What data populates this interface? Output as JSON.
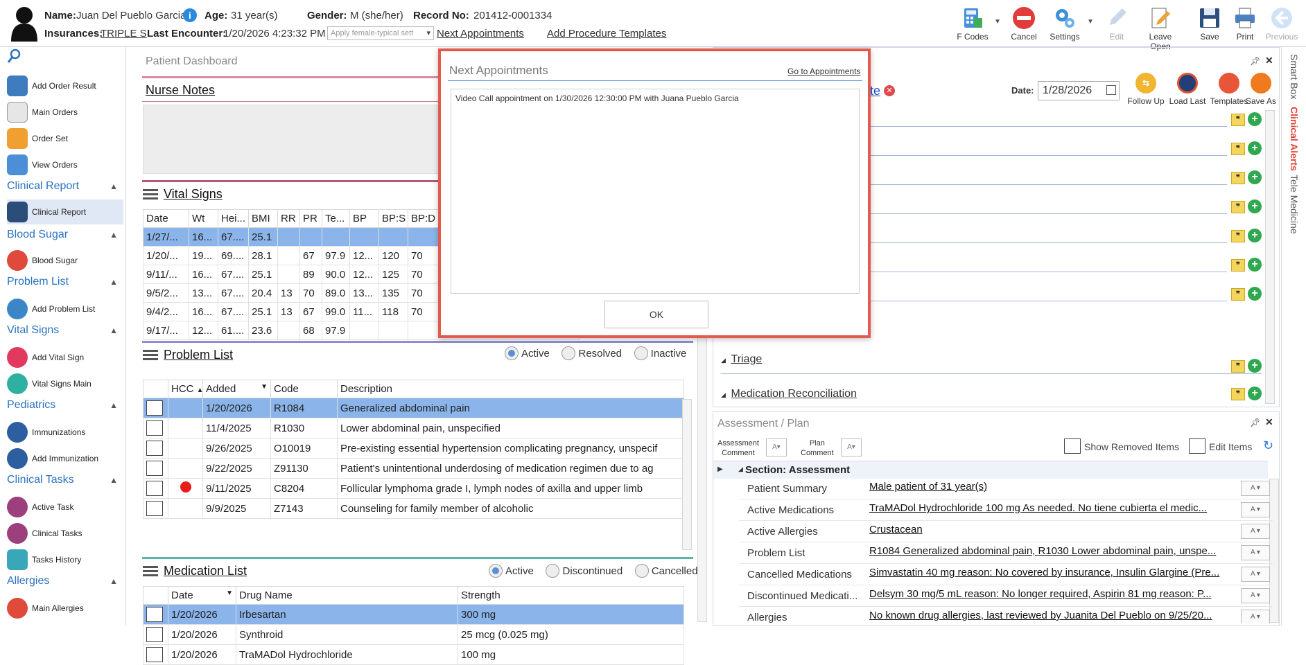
{
  "header": {
    "name_label": "Name:",
    "name_value": "Juan Del Pueblo Garcia",
    "age_label": "Age:",
    "age_value": "31 year(s)",
    "gender_label": "Gender:",
    "gender_value": "M (she/her)",
    "record_label": "Record No:",
    "record_value": "201412-0001334",
    "ins_label": "Insurances:",
    "ins_value": "TRIPLE S",
    "last_enc_label": "Last Encounter:",
    "last_enc_value": "1/20/2026 4:23:32 PM",
    "template_select": "Apply female-typical sett",
    "next_appts_link": "Next Appointments",
    "add_proc_link": "Add Procedure Templates"
  },
  "toolbar": [
    {
      "label": "F Codes",
      "icon": "calculator-icon",
      "enabled": true
    },
    {
      "label": "Cancel",
      "icon": "cancel-icon",
      "enabled": true
    },
    {
      "label": "Settings",
      "icon": "gear-icon",
      "enabled": true
    },
    {
      "label": "Edit",
      "icon": "pencil-icon",
      "enabled": false
    },
    {
      "label": "Leave Open",
      "icon": "edit-doc-icon",
      "enabled": true
    },
    {
      "label": "Save",
      "icon": "floppy-icon",
      "enabled": true
    },
    {
      "label": "Print",
      "icon": "printer-icon",
      "enabled": true
    },
    {
      "label": "Previous",
      "icon": "back-arrow-icon",
      "enabled": false
    }
  ],
  "sidebar": {
    "items": [
      {
        "label": "Add Order Result"
      },
      {
        "label": "Main Orders"
      },
      {
        "label": "Order Set"
      },
      {
        "label": "View Orders"
      }
    ],
    "sections": [
      {
        "title": "Clinical Report",
        "items": [
          "Clinical Report"
        ]
      },
      {
        "title": "Blood Sugar",
        "items": [
          "Blood Sugar"
        ]
      },
      {
        "title": "Problem List",
        "items": [
          "Add Problem List"
        ]
      },
      {
        "title": "Vital Signs",
        "items": [
          "Add Vital Sign",
          "Vital Signs Main"
        ]
      },
      {
        "title": "Pediatrics",
        "items": [
          "Immunizations",
          "Add Immunization"
        ]
      },
      {
        "title": "Clinical Tasks",
        "items": [
          "Active Task",
          "Clinical Tasks",
          "Tasks History"
        ]
      },
      {
        "title": "Allergies",
        "items": [
          "Main Allergies"
        ]
      }
    ]
  },
  "dashboard": {
    "title": "Patient Dashboard",
    "nurse_notes": "Nurse Notes",
    "vital_signs": {
      "title": "Vital Signs",
      "columns": [
        "Date",
        "Wt",
        "Hei...",
        "BMI",
        "RR",
        "PR",
        "Te...",
        "BP",
        "BP:S",
        "BP:D"
      ],
      "rows": [
        [
          "1/27/...",
          "16...",
          "67....",
          "25.1",
          "",
          "",
          "",
          "",
          "",
          ""
        ],
        [
          "1/20/...",
          "19...",
          "69....",
          "28.1",
          "",
          "67",
          "97.9",
          "12...",
          "120",
          "70"
        ],
        [
          "9/11/...",
          "16...",
          "67....",
          "25.1",
          "",
          "89",
          "90.0",
          "12...",
          "125",
          "70"
        ],
        [
          "9/5/2...",
          "13...",
          "67....",
          "20.4",
          "13",
          "70",
          "89.0",
          "13...",
          "135",
          "70"
        ],
        [
          "9/4/2...",
          "16...",
          "67....",
          "25.1",
          "13",
          "67",
          "99.0",
          "11...",
          "118",
          "70"
        ],
        [
          "9/17/...",
          "12...",
          "61....",
          "23.6",
          "",
          "68",
          "97.9",
          "",
          "",
          ""
        ]
      ]
    },
    "problem_list": {
      "title": "Problem List",
      "filters": [
        "Active",
        "Resolved",
        "Inactive"
      ],
      "columns": [
        "HCC",
        "Added",
        "Code",
        "Description"
      ],
      "rows": [
        {
          "hcc": false,
          "added": "1/20/2026",
          "code": "R1084",
          "desc": "Generalized abdominal pain"
        },
        {
          "hcc": false,
          "added": "11/4/2025",
          "code": "R1030",
          "desc": "Lower abdominal pain, unspecified"
        },
        {
          "hcc": false,
          "added": "9/26/2025",
          "code": "O10019",
          "desc": "Pre-existing essential hypertension complicating pregnancy, unspecif"
        },
        {
          "hcc": false,
          "added": "9/22/2025",
          "code": "Z91130",
          "desc": "Patient's unintentional underdosing of medication regimen due to ag"
        },
        {
          "hcc": true,
          "added": "9/11/2025",
          "code": "C8204",
          "desc": "Follicular lymphoma grade I, lymph nodes of axilla and upper limb"
        },
        {
          "hcc": false,
          "added": "9/9/2025",
          "code": "Z7143",
          "desc": "Counseling for family member of alcoholic"
        }
      ]
    },
    "medication_list": {
      "title": "Medication List",
      "filters": [
        "Active",
        "Discontinued",
        "Cancelled"
      ],
      "columns": [
        "Date",
        "Drug Name",
        "Strength"
      ],
      "rows": [
        {
          "date": "1/20/2026",
          "drug": "Irbesartan",
          "strength": "300 mg"
        },
        {
          "date": "1/20/2026",
          "drug": "Synthroid",
          "strength": "25 mcg (0.025 mg)"
        },
        {
          "date": "1/20/2026",
          "drug": "TraMADol Hydrochloride",
          "strength": "100 mg"
        }
      ]
    }
  },
  "note_panel": {
    "title_suffix": "te",
    "date_label": "Date:",
    "date_value": "1/28/2026",
    "actions": [
      "Follow Up",
      "Load Last",
      "Templates",
      "Save As"
    ],
    "sections": [
      "Triage",
      "Medication Reconciliation"
    ]
  },
  "right_tabs": [
    "Smart Box",
    "Clinical Alerts",
    "Tele Medicine"
  ],
  "assessment": {
    "title": "Assessment / Plan",
    "comment_label_1": "Assessment",
    "comment_label_2": "Comment",
    "plan_label_1": "Plan",
    "plan_label_2": "Comment",
    "show_removed": "Show Removed Items",
    "edit_items": "Edit Items",
    "section": "Section: Assessment",
    "rows": [
      {
        "k": "Patient Summary",
        "v": "Male patient of 31 year(s)"
      },
      {
        "k": "Active Medications",
        "v": "TraMADol Hydrochloride 100 mg As needed.  No tiene cubierta el medic..."
      },
      {
        "k": "Active Allergies",
        "v": "Crustacean"
      },
      {
        "k": "Problem List",
        "v": "R1084 Generalized abdominal pain, R1030 Lower abdominal pain, unspe..."
      },
      {
        "k": "Cancelled Medications",
        "v": "Simvastatin 40 mg reason: No covered by insurance, Insulin Glargine (Pre..."
      },
      {
        "k": "Discontinued Medicati...",
        "v": "Delsym 30 mg/5 mL reason: No longer required, Aspirin 81 mg reason: P..."
      },
      {
        "k": "Allergies",
        "v": "No known drug allergies, last reviewed by Juanita Del Pueblo on 9/25/20..."
      }
    ]
  },
  "modal": {
    "title": "Next Appointments",
    "goto_link": "Go to Appointments",
    "content": "Video Call appointment on 1/30/2026 12:30:00 PM with Juana Pueblo Garcia",
    "ok": "OK"
  }
}
